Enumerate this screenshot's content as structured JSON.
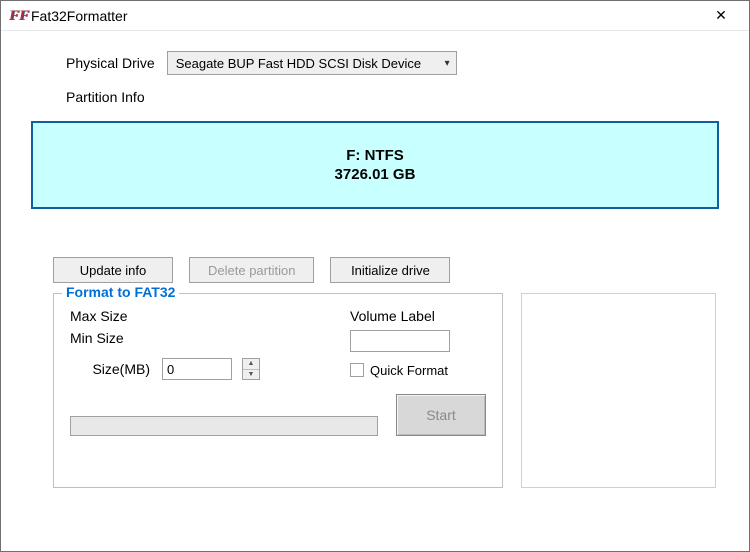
{
  "window": {
    "title": "Fat32Formatter"
  },
  "drive": {
    "label": "Physical Drive",
    "selected": "Seagate BUP Fast HDD SCSI Disk Device"
  },
  "partition": {
    "label": "Partition Info",
    "drive_letter_fs": "F: NTFS",
    "size": "3726.01 GB"
  },
  "buttons": {
    "update": "Update info",
    "delete": "Delete partition",
    "init": "Initialize drive"
  },
  "format": {
    "legend": "Format to FAT32",
    "max_label": "Max Size",
    "max_value": "",
    "min_label": "Min Size",
    "min_value": "",
    "size_label": "Size(MB)",
    "size_value": "0",
    "vol_label": "Volume Label",
    "vol_value": "",
    "quick_label": "Quick Format",
    "quick_checked": false,
    "start_label": "Start"
  }
}
